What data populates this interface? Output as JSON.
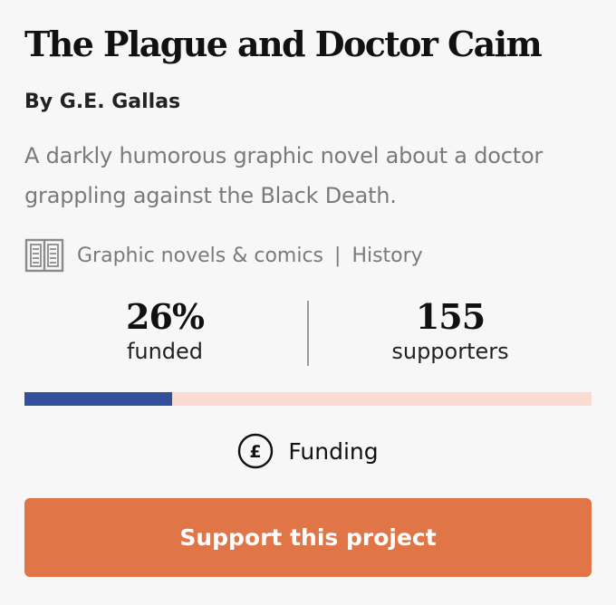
{
  "project": {
    "title": "The Plague and Doctor Caim",
    "author": "By G.E. Gallas",
    "description": "A darkly humorous graphic novel about a doctor grappling against the Black Death.",
    "category_icon": "book-icon",
    "categories": [
      "Graphic novels & comics",
      "History"
    ],
    "category_separator": "|"
  },
  "stats": {
    "funded_value": "26%",
    "funded_label": "funded",
    "supporters_value": "155",
    "supporters_label": "supporters"
  },
  "progress": {
    "fraction": 0.26,
    "fill_color": "#33509b",
    "track_color": "#fadbd1"
  },
  "status": {
    "icon": "pound-icon",
    "label": "Funding"
  },
  "cta": {
    "label": "Support this project",
    "color": "#e07548"
  }
}
